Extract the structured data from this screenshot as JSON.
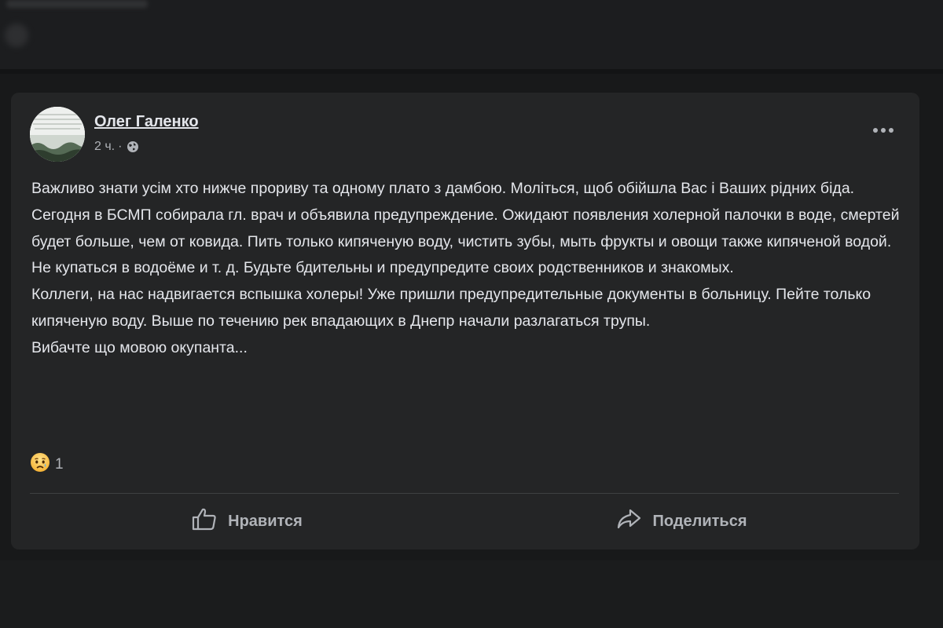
{
  "post": {
    "author": "Олег Галенко",
    "time": "2 ч.",
    "separator": "·",
    "privacy_icon": "globe-icon",
    "more_icon": "more-dots-icon",
    "paragraphs": [
      "Важливо знати усім хто нижче прориву та одному плато з дамбою. Моліться, щоб обійшла Вас і Ваших рідних біда.",
      "Сегодня в БСМП собирала гл. врач и объявила предупреждение. Ожидают появления холерной палочки в воде, смертей будет больше, чем от ковида. Пить только кипяченую воду, чистить зубы, мыть фрукты и овощи также кипяченой водой. Не купаться в водоёме и т. д. Будьте бдительны и предупредите своих родственников и знакомых.",
      "Коллеги, на нас надвигается вспышка холеры! Уже пришли предупредительные документы в больницу. Пейте только кипяченую воду. Выше по течению рек впадающих в Днепр начали разлагаться трупы.",
      "Вибачте що мовою окупанта..."
    ],
    "reaction_icon": "sad-face-icon",
    "reaction_count": "1"
  },
  "actions": {
    "like_label": "Нравится",
    "like_icon": "thumbs-up-icon",
    "share_label": "Поделиться",
    "share_icon": "share-arrow-icon"
  },
  "colors": {
    "page_bg": "#18191a",
    "card_bg": "#242526",
    "primary_text": "#e4e6eb",
    "secondary_text": "#b0b3b8",
    "divider": "#3e4042"
  }
}
